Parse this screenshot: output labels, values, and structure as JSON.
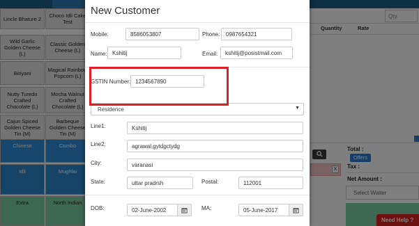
{
  "background": {
    "product_tiles": [
      {
        "label": "Lincle Bhature 2"
      },
      {
        "label": "Choco Idli Cake Test"
      },
      {
        "label": "Wild Garlic Golden Cheese (L)"
      },
      {
        "label": "Classic Golden Cheese (L)"
      },
      {
        "label": "Biriyani"
      },
      {
        "label": "Magical Rainbow Popcorn (L)"
      },
      {
        "label": "Nutty Turedo Crafted Chocolate (L)"
      },
      {
        "label": "Mocha Walnut Crafted Chocolate (L)"
      },
      {
        "label": "Cajun Spiced Golden Cheese Tin (M)"
      },
      {
        "label": "Barbeque Golden Cheese Tin (M)"
      }
    ],
    "category_tiles": [
      {
        "label": "Chinese"
      },
      {
        "label": "Combo"
      },
      {
        "label": "Idli"
      },
      {
        "label": "Mughlai"
      },
      {
        "label": "Extra"
      },
      {
        "label": "North Indian"
      }
    ],
    "qty_placeholder": "Qty",
    "table_headers": {
      "quantity": "Quantity",
      "rate": "Rate"
    },
    "x_label": "X",
    "total_label": "Total :",
    "offers_label": "Offers",
    "tax_label": "Tax :",
    "net_amount_label": "Net Amount :",
    "select_waiter": "Select Waiter",
    "need_help": "Need Help ?"
  },
  "modal": {
    "title": "New Customer",
    "mobile_label": "Mobile:",
    "mobile_value": "8586053807",
    "phone_label": "Phone:",
    "phone_value": "0987654321",
    "name_label": "Name:",
    "name_value": "Kshitij",
    "email_label": "Email:",
    "email_value": "kshitij@posistmail.com",
    "gstin_label": "GSTIN Number:",
    "gstin_value": "1234567890",
    "address_type": "Residence",
    "line1_label": "Line1:",
    "line1_value": "Kshitij",
    "line2_label": "Line2:",
    "line2_value": "agrawal,gytdgctydg",
    "city_label": "City:",
    "city_value": "varanasi",
    "state_label": "State:",
    "state_value": "uttar pradrsh",
    "postal_label": "Postal:",
    "postal_value": "112001",
    "dob_label": "DOB:",
    "dob_value": "02-June-2002",
    "ma_label": "MA:",
    "ma_value": "05-June-2017"
  },
  "colors": {
    "highlight": "#e01e25",
    "brand_blue": "#2e7bd1",
    "need_help_red": "#d9231f"
  }
}
